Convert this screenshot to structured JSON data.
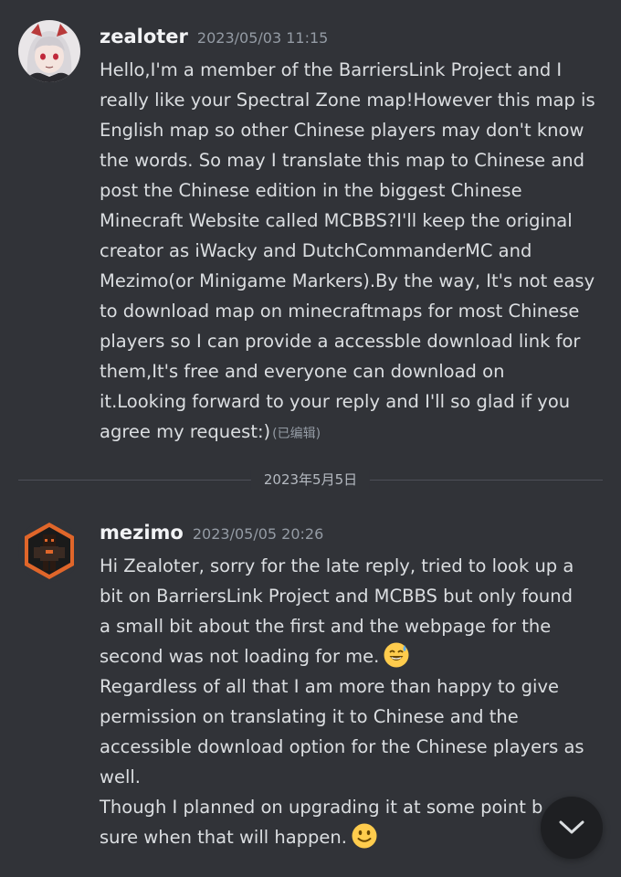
{
  "messages": [
    {
      "author": "zealoter",
      "timestamp": "2023/05/03 11:15",
      "lines": [
        "Hello,I'm a member of the BarriersLink Project and I",
        "really like your Spectral Zone map!However this map is",
        "English map so other Chinese players may don't know",
        "the words. So may I translate this map to Chinese and",
        "post the Chinese edition in the biggest Chinese",
        "Minecraft Website called MCBBS?I'll keep the original",
        "creator as iWacky and DutchCommanderMC and",
        "Mezimo(or Minigame Markers).By the way, It's not easy",
        "to download map on minecraftmaps for most Chinese",
        "players so I can provide a accessble download link for",
        "them,It's free and everyone can download on",
        "it.Looking forward to your reply and I'll so glad if you",
        "agree my request:)"
      ],
      "edited_label": "(已编辑)"
    },
    {
      "author": "mezimo",
      "timestamp": "2023/05/05 20:26",
      "lines": [
        "Hi Zealoter, sorry for the late reply, tried to look up a",
        "bit on BarriersLink Project and MCBBS but only found",
        "a small bit about the first and the webpage for the",
        "second was not loading for me.",
        "Regardless of all that I am more than happy to give",
        "permission on translating it to Chinese and the",
        "accessible download option for the Chinese players as",
        "well.",
        "Though I planned on upgrading it at some point b",
        "sure when that will happen."
      ],
      "emojis": [
        "sweat-smile-emoji",
        "slight-smile-emoji"
      ]
    }
  ],
  "date_divider": "2023年5月5日",
  "scroll_button": {
    "icon": "chevron-down-icon"
  },
  "colors": {
    "background": "#313338",
    "author": "#f2f3f5",
    "timestamp": "#949ba4",
    "text": "#dbdee1"
  }
}
